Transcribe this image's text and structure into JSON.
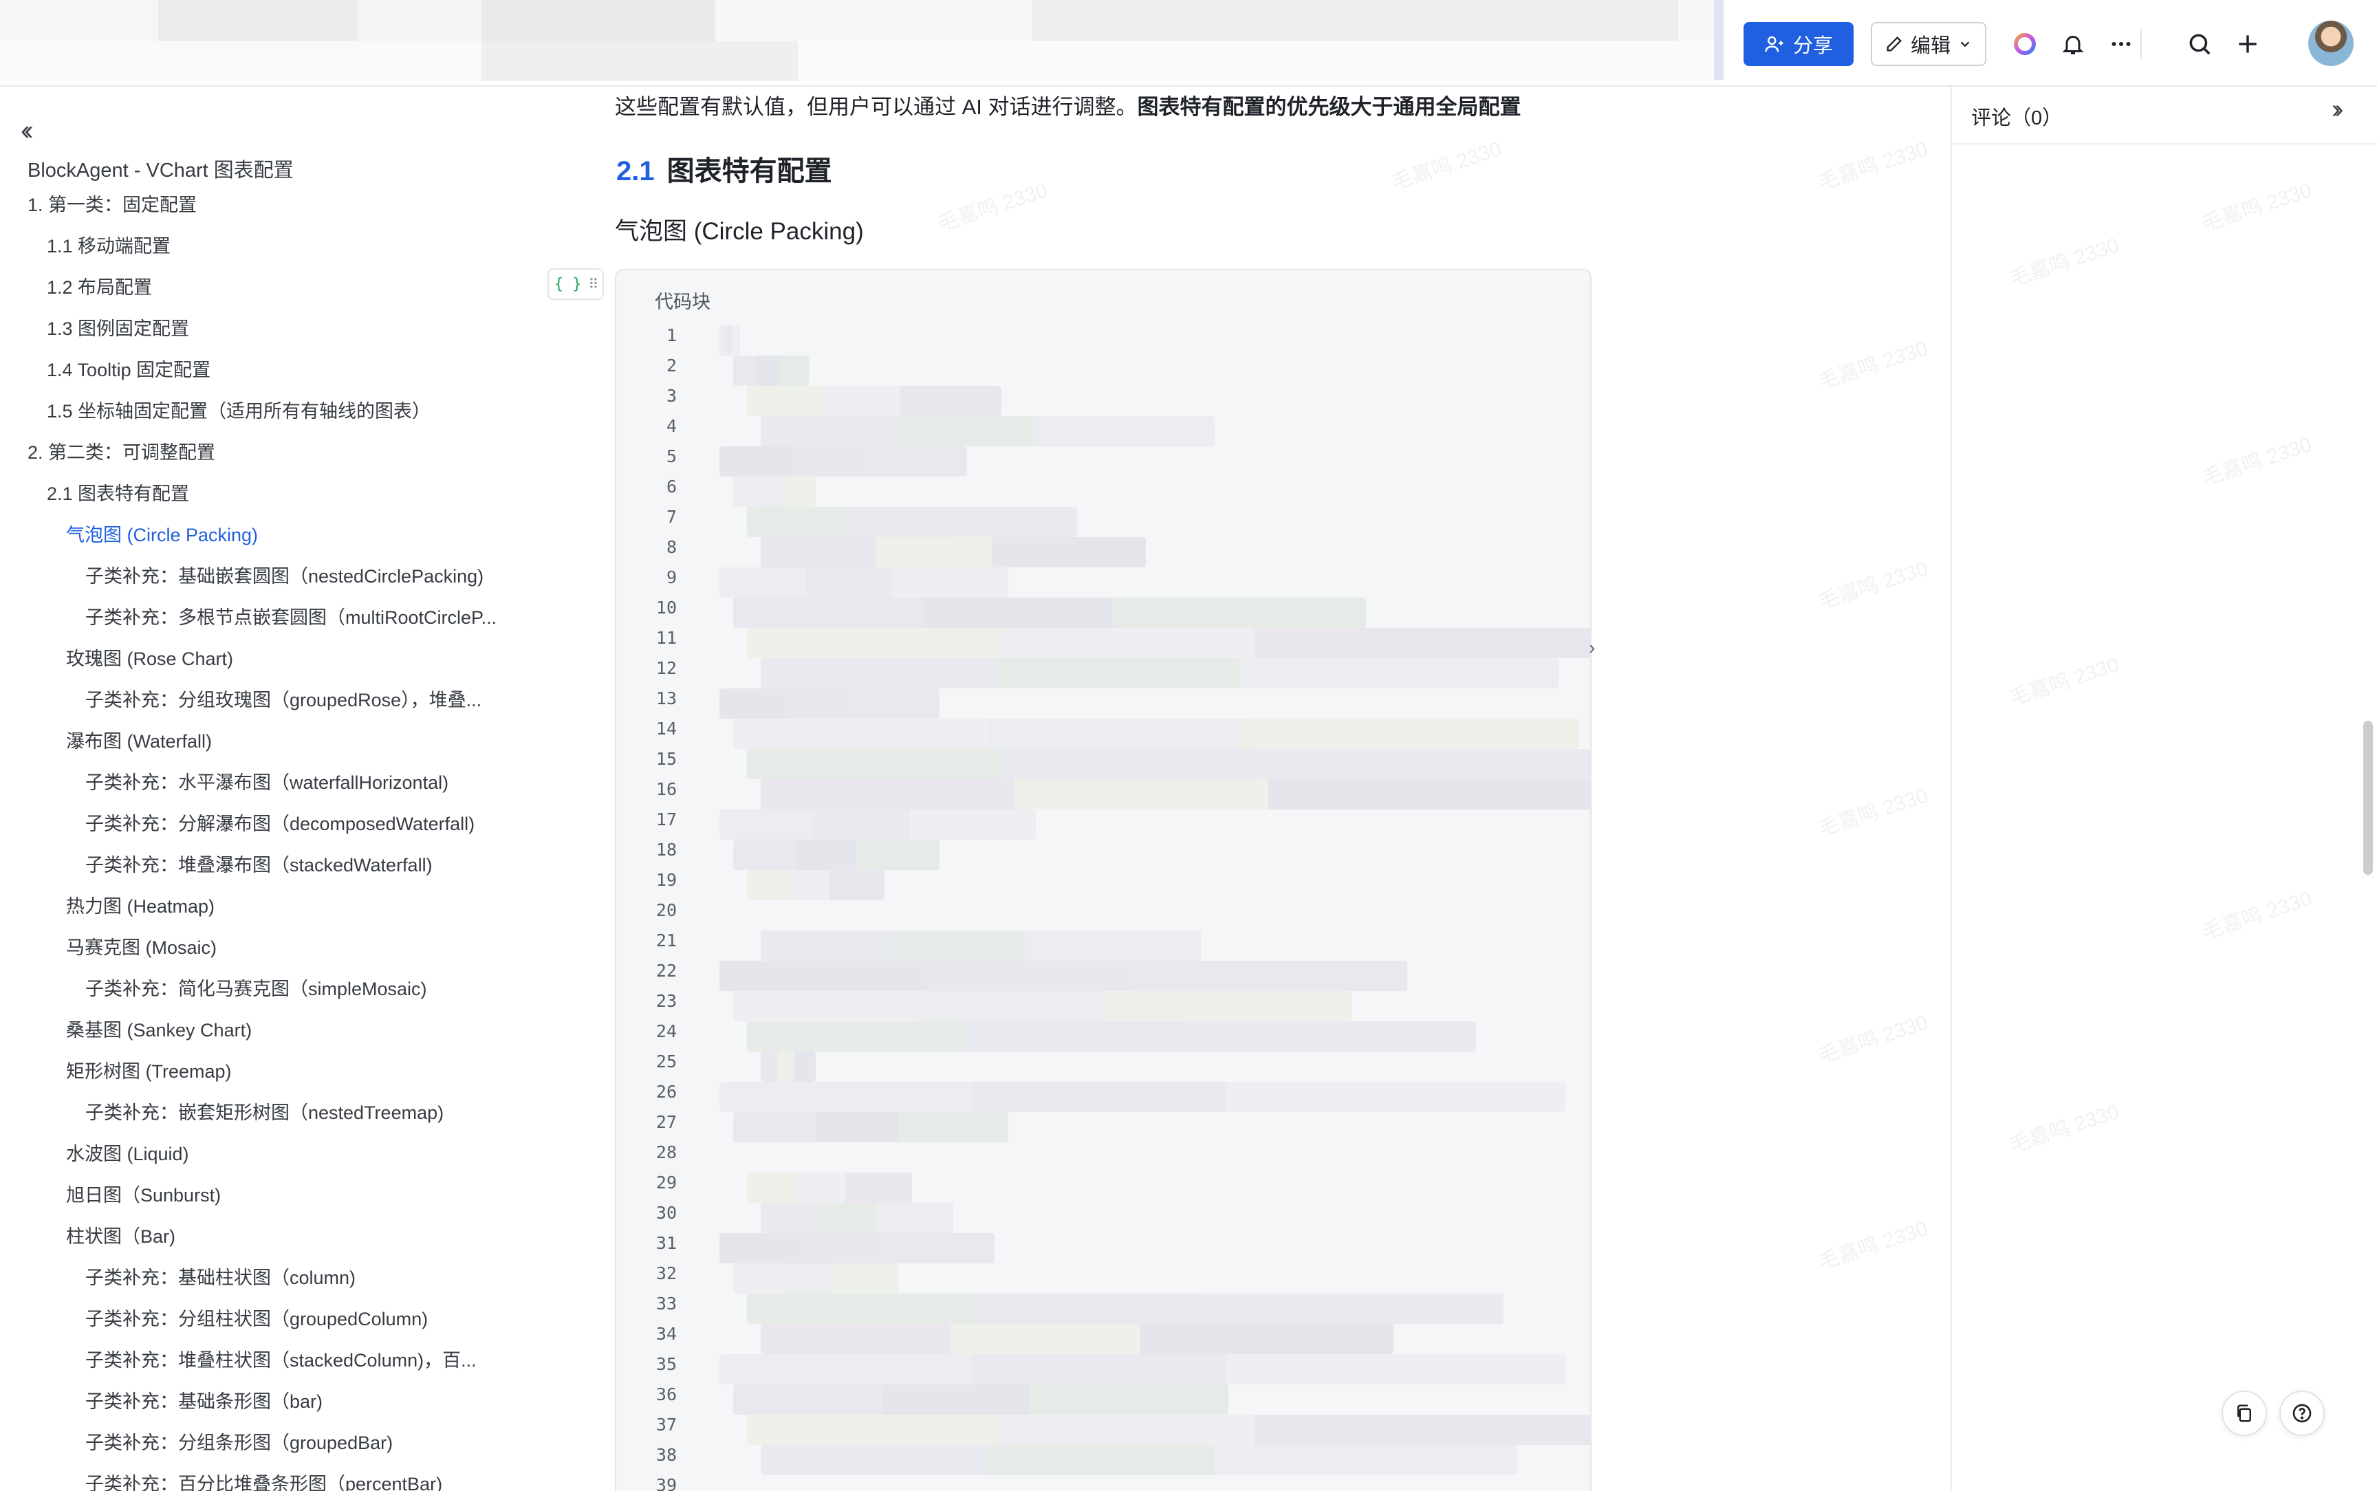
{
  "topbar": {
    "share_label": "分享",
    "edit_label": "编辑"
  },
  "sidebar": {
    "doc_title": "BlockAgent - VChart 图表配置",
    "items": [
      {
        "label": "1. 第一类：固定配置"
      },
      {
        "label": "1.1 移动端配置"
      },
      {
        "label": "1.2 布局配置"
      },
      {
        "label": "1.3 图例固定配置"
      },
      {
        "label": "1.4 Tooltip 固定配置"
      },
      {
        "label": "1.5 坐标轴固定配置（适用所有有轴线的图表）"
      },
      {
        "label": "2. 第二类：可调整配置"
      },
      {
        "label": "2.1 图表特有配置"
      },
      {
        "label": "气泡图 (Circle Packing)"
      },
      {
        "label": "子类补充：基础嵌套圆图（nestedCirclePacking)"
      },
      {
        "label": "子类补充：多根节点嵌套圆图（multiRootCircleP..."
      },
      {
        "label": "玫瑰图 (Rose Chart)"
      },
      {
        "label": "子类补充：分组玫瑰图（groupedRose），堆叠..."
      },
      {
        "label": "瀑布图 (Waterfall)"
      },
      {
        "label": "子类补充：水平瀑布图（waterfallHorizontal)"
      },
      {
        "label": "子类补充：分解瀑布图（decomposedWaterfall)"
      },
      {
        "label": "子类补充：堆叠瀑布图（stackedWaterfall)"
      },
      {
        "label": "热力图 (Heatmap)"
      },
      {
        "label": "马赛克图 (Mosaic)"
      },
      {
        "label": "子类补充：简化马赛克图（simpleMosaic)"
      },
      {
        "label": "桑基图 (Sankey Chart)"
      },
      {
        "label": "矩形树图 (Treemap)"
      },
      {
        "label": "子类补充：嵌套矩形树图（nestedTreemap)"
      },
      {
        "label": "水波图 (Liquid)"
      },
      {
        "label": "旭日图（Sunburst)"
      },
      {
        "label": "柱状图（Bar)"
      },
      {
        "label": "子类补充：基础柱状图（column)"
      },
      {
        "label": "子类补充：分组柱状图（groupedColumn)"
      },
      {
        "label": "子类补充：堆叠柱状图（stackedColumn)，百..."
      },
      {
        "label": "子类补充：基础条形图（bar)"
      },
      {
        "label": "子类补充：分组条形图（groupedBar)"
      },
      {
        "label": "子类补充：百分比堆叠条形图（percentBar)"
      }
    ]
  },
  "main": {
    "intro_text": "这些配置有默认值，但用户可以通过 AI 对话进行调整。",
    "intro_bold": "图表特有配置的优先级大于通用全局配置",
    "section_number": "2.1",
    "section_title": "图表特有配置",
    "subsection_title": "气泡图 (Circle Packing)",
    "block_handle_label": "{ }",
    "code_label": "代码块",
    "line_numbers": [
      "1",
      "2",
      "3",
      "4",
      "5",
      "6",
      "7",
      "8",
      "9",
      "10",
      "11",
      "12",
      "13",
      "14",
      "15",
      "16",
      "17",
      "18",
      "19",
      "20",
      "21",
      "22",
      "23",
      "24",
      "25",
      "26",
      "27",
      "28",
      "29",
      "30",
      "31",
      "32",
      "33",
      "34",
      "35",
      "36",
      "37",
      "38",
      "39"
    ],
    "watermark": "毛嘉鸣 2330"
  },
  "comments": {
    "title": "评论（0）"
  },
  "colors": {
    "accent": "#1f5fe0",
    "text": "#1f2329",
    "code_bg": "#f5f6f7"
  }
}
